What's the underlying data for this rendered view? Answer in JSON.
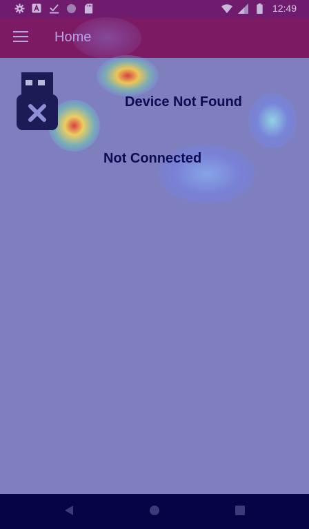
{
  "status_bar": {
    "time": "12:49",
    "left_icons": [
      "settings-icon",
      "font-icon",
      "check-icon",
      "circle-icon",
      "sd-card-icon"
    ],
    "right_icons": [
      "wifi-icon",
      "signal-icon",
      "battery-icon"
    ]
  },
  "app_bar": {
    "title": "Home",
    "menu_icon": "hamburger-menu-icon"
  },
  "content": {
    "device_icon": "usb-off-icon",
    "device_title": "Device Not Found",
    "connection_status": "Not Connected"
  },
  "nav_bar": {
    "buttons": [
      "back-icon",
      "home-icon",
      "recents-icon"
    ]
  },
  "colors": {
    "status_bar": "#6f1b6e",
    "app_bar": "#7c1b64",
    "background": "#7f7fbf",
    "text_dark": "#0b0b52",
    "nav_bar": "#050545"
  }
}
